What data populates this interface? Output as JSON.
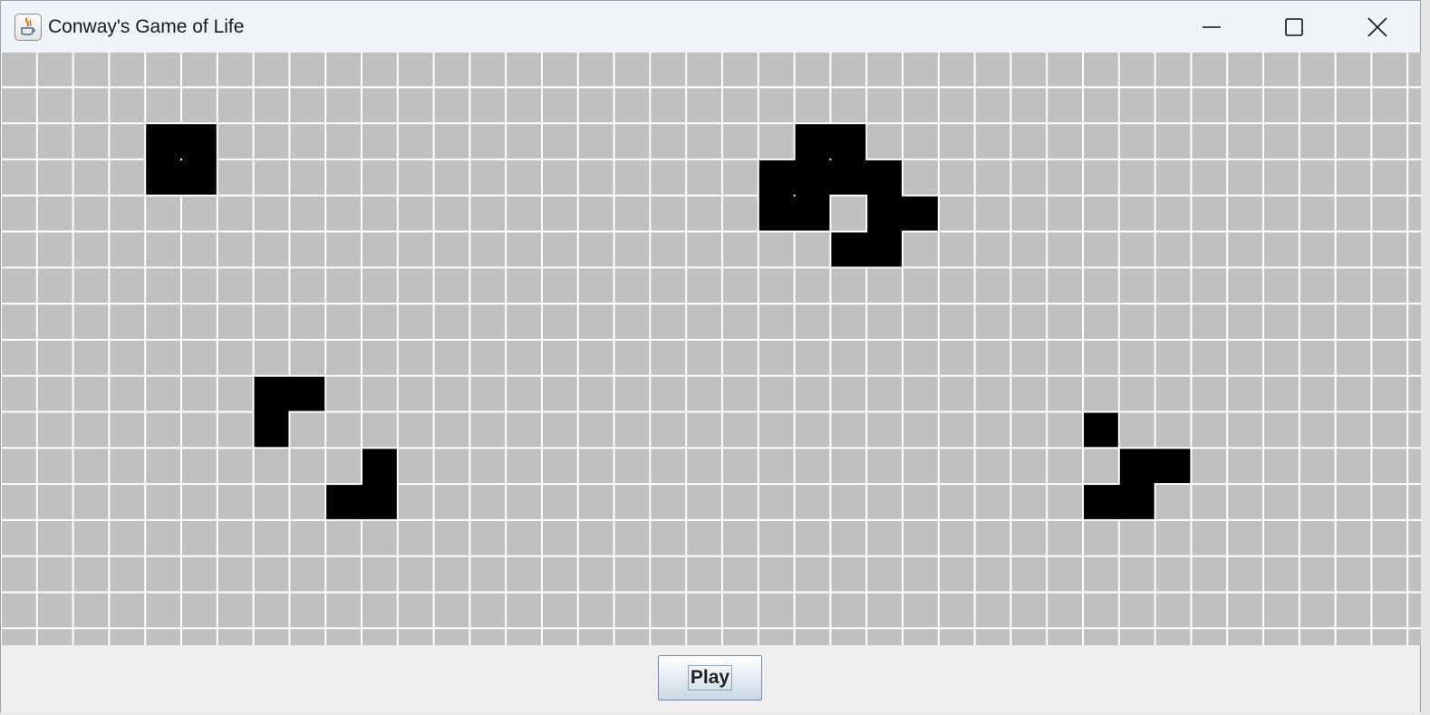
{
  "window": {
    "title": "Conway's Game of Life",
    "icon": "java-icon"
  },
  "titlebar_controls": [
    {
      "name": "minimize",
      "icon": "minimize-icon"
    },
    {
      "name": "maximize",
      "icon": "maximize-icon"
    },
    {
      "name": "close",
      "icon": "close-icon"
    }
  ],
  "board": {
    "columns": 40,
    "rows": 17,
    "dead_color": "#c0c0c0",
    "alive_color": "#000000",
    "gridline_color": "#ffffff",
    "alive_cells": [
      [
        4,
        2
      ],
      [
        5,
        2
      ],
      [
        4,
        3
      ],
      [
        5,
        3
      ],
      [
        22,
        2
      ],
      [
        23,
        2
      ],
      [
        21,
        3
      ],
      [
        22,
        3
      ],
      [
        23,
        3
      ],
      [
        24,
        3
      ],
      [
        21,
        4
      ],
      [
        22,
        4
      ],
      [
        24,
        4
      ],
      [
        25,
        4
      ],
      [
        23,
        5
      ],
      [
        24,
        5
      ],
      [
        7,
        9
      ],
      [
        8,
        9
      ],
      [
        7,
        10
      ],
      [
        10,
        11
      ],
      [
        9,
        12
      ],
      [
        10,
        12
      ],
      [
        30,
        10
      ],
      [
        31,
        11
      ],
      [
        32,
        11
      ],
      [
        30,
        12
      ],
      [
        31,
        12
      ]
    ]
  },
  "controls": {
    "play_label": "Play"
  }
}
